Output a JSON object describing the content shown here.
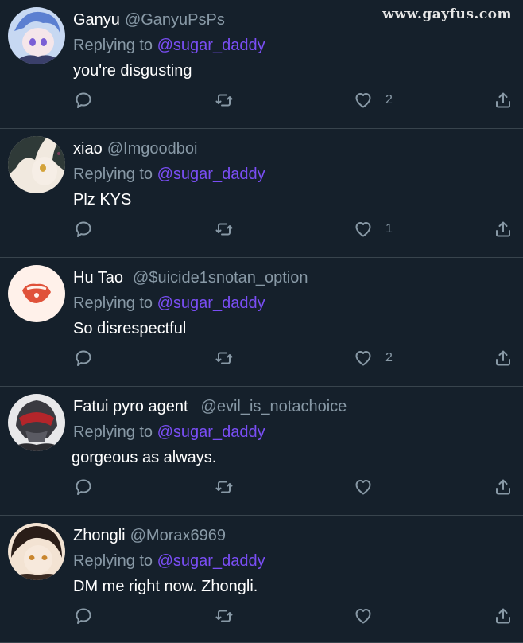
{
  "watermark": "www.gayfus.com",
  "tweets": [
    {
      "name": "Ganyu",
      "handle": "@GanyuPsPs",
      "reply_prefix": "Replying to",
      "mention": "@sugar_daddy",
      "text": "you're disgusting",
      "likes": "2",
      "avatar_colors": [
        "#c7d8f2",
        "#5b7fd1"
      ]
    },
    {
      "name": "xiao",
      "handle": "@Imgoodboi",
      "reply_prefix": "Replying to",
      "mention": "@sugar_daddy",
      "text": "Plz KYS",
      "likes": "1",
      "avatar_colors": [
        "#f1e9df",
        "#2f3a38"
      ]
    },
    {
      "name": "Hu Tao",
      "handle": "@$uicide1snotan_option",
      "reply_prefix": "Replying to",
      "mention": "@sugar_daddy",
      "text": "So disrespectful",
      "likes": "2",
      "avatar_colors": [
        "#fff1ea",
        "#e0523a"
      ]
    },
    {
      "name": "Fatui pyro agent",
      "handle": "@evil_is_notachoice",
      "reply_prefix": "Replying to",
      "mention": "@sugar_daddy",
      "text": "gorgeous as always.",
      "likes": "",
      "avatar_colors": [
        "#e8e8ea",
        "#b3252a"
      ]
    },
    {
      "name": "Zhongli",
      "handle": "@Morax6969",
      "reply_prefix": "Replying to",
      "mention": "@sugar_daddy",
      "text": "DM me right now. Zhongli.",
      "likes": "",
      "avatar_colors": [
        "#f3e3d3",
        "#2a1d18"
      ]
    }
  ]
}
